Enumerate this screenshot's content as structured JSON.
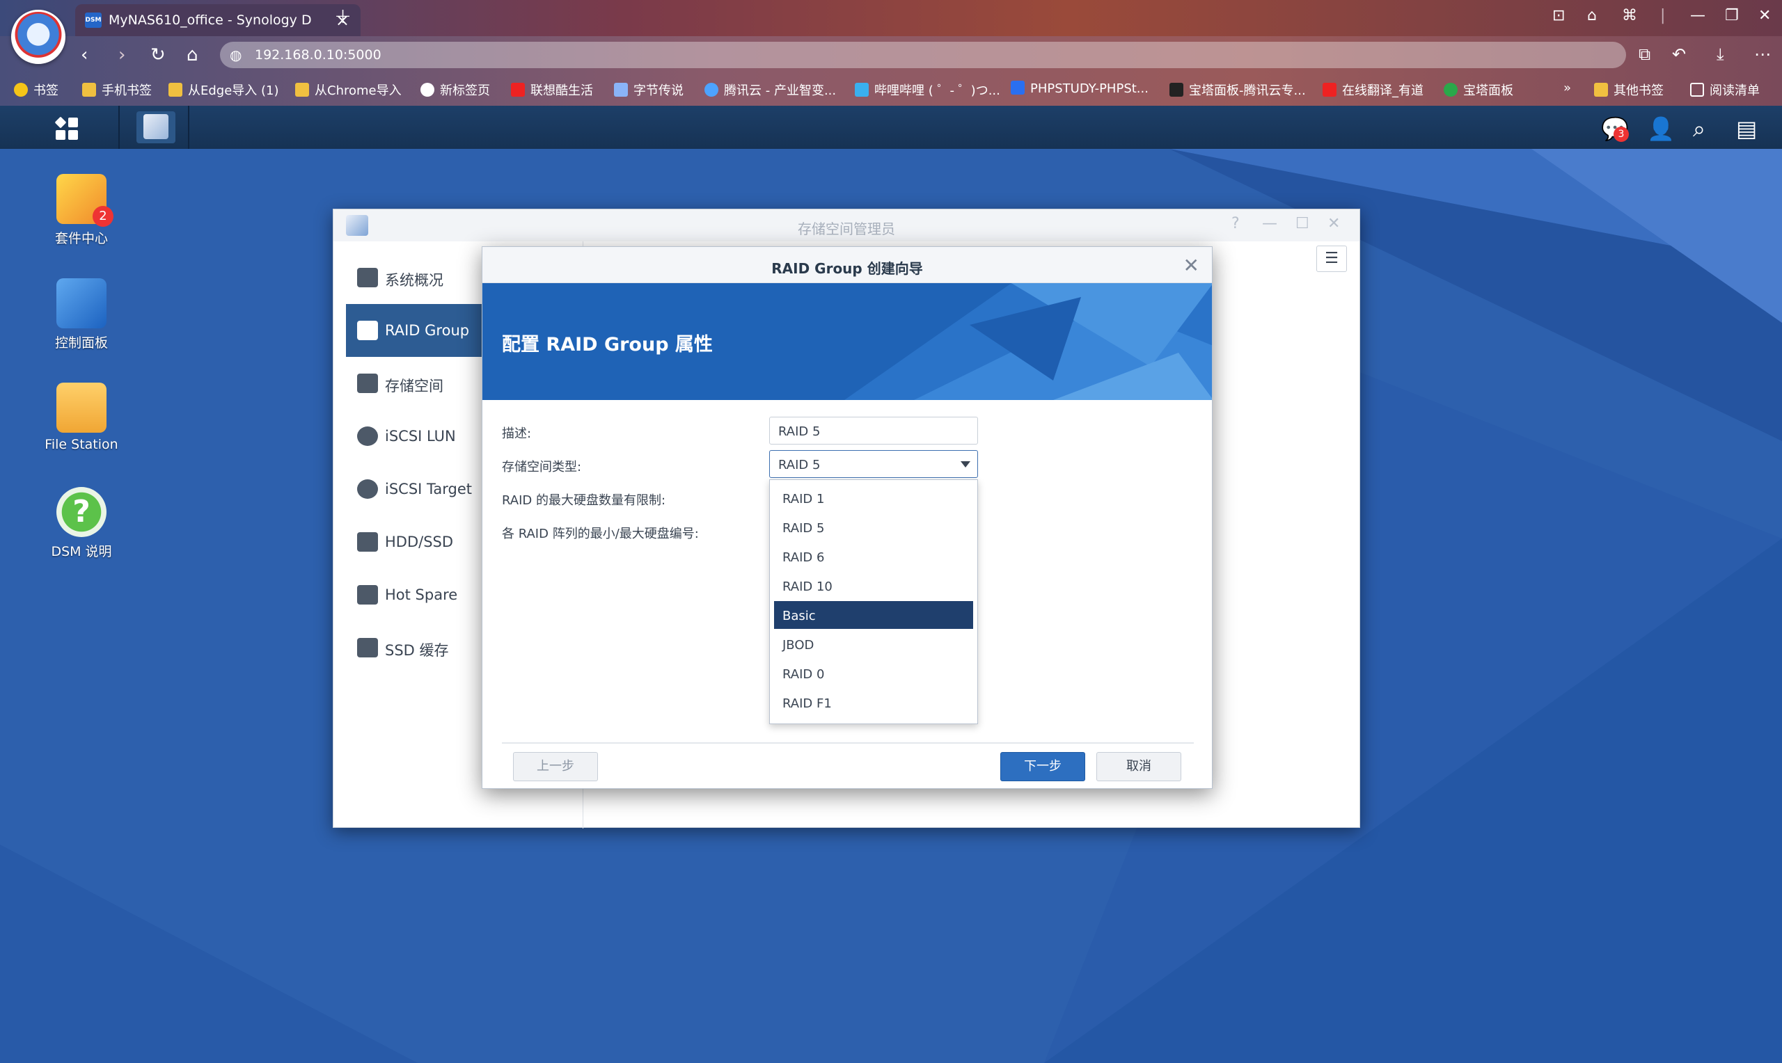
{
  "browser": {
    "tab_title": "MyNAS610_office - Synology D",
    "tab_favicon_text": "DSM",
    "url": "192.168.0.10:5000",
    "bookmarks": [
      {
        "label": "书签",
        "icon": "star-icon",
        "color": "#f5c518"
      },
      {
        "label": "手机书签",
        "icon": "folder-icon",
        "color": "#f0c040"
      },
      {
        "label": "从Edge导入 (1)",
        "icon": "folder-icon",
        "color": "#f0c040"
      },
      {
        "label": "从Chrome导入",
        "icon": "folder-icon",
        "color": "#f0c040"
      },
      {
        "label": "新标签页",
        "icon": "browser-icon",
        "color": "#ffffff"
      },
      {
        "label": "联想酷生活",
        "icon": "lenovo-icon",
        "color": "#e22"
      },
      {
        "label": "字节传说",
        "icon": "byte-icon",
        "color": "#8ab4f8"
      },
      {
        "label": "腾讯云 - 产业智变...",
        "icon": "cloud-icon",
        "color": "#4da3ff"
      },
      {
        "label": "哔哩哔哩 ( ゜- ゜)つ...",
        "icon": "bilibili-icon",
        "color": "#3ab0ef"
      },
      {
        "label": "PHPSTUDY-PHPSt...",
        "icon": "phpstudy-icon",
        "color": "#2a6ff0"
      },
      {
        "label": "宝塔面板-腾讯云专...",
        "icon": "bt-icon",
        "color": "#222222"
      },
      {
        "label": "在线翻译_有道",
        "icon": "youdao-icon",
        "color": "#e22"
      },
      {
        "label": "宝塔面板",
        "icon": "leaf-icon",
        "color": "#2aa84a"
      }
    ],
    "more_bookmarks": "»",
    "other_bookmarks": "其他书签",
    "reading_list": "阅读清单"
  },
  "taskbar": {
    "notification_count": "3"
  },
  "desktop_icons": [
    {
      "label": "套件中心",
      "badge": "2"
    },
    {
      "label": "控制面板"
    },
    {
      "label": "File Station"
    },
    {
      "label": "DSM 说明"
    }
  ],
  "storage_manager": {
    "title": "存储空间管理员",
    "sidebar": [
      {
        "label": "系统概况",
        "icon": "overview-icon"
      },
      {
        "label": "RAID Group",
        "icon": "raid-group-icon",
        "active": true
      },
      {
        "label": "存储空间",
        "icon": "volume-icon"
      },
      {
        "label": "iSCSI LUN",
        "icon": "lun-icon"
      },
      {
        "label": "iSCSI Target",
        "icon": "target-icon"
      },
      {
        "label": "HDD/SSD",
        "icon": "disk-icon"
      },
      {
        "label": "Hot Spare",
        "icon": "hot-spare-icon"
      },
      {
        "label": "SSD 缓存",
        "icon": "ssd-cache-icon"
      }
    ]
  },
  "wizard": {
    "title": "RAID Group 创建向导",
    "banner_title": "配置 RAID Group 属性",
    "fields": {
      "description_label": "描述:",
      "description_value": "RAID 5",
      "type_label": "存储空间类型:",
      "type_value": "RAID 5",
      "max_disk_label": "RAID 的最大硬盘数量有限制:",
      "min_max_label": "各 RAID 阵列的最小/最大硬盘编号:"
    },
    "options": [
      "RAID 1",
      "RAID 5",
      "RAID 6",
      "RAID 10",
      "Basic",
      "JBOD",
      "RAID 0",
      "RAID F1"
    ],
    "highlighted_option": "Basic",
    "buttons": {
      "back": "上一步",
      "next": "下一步",
      "cancel": "取消"
    }
  }
}
